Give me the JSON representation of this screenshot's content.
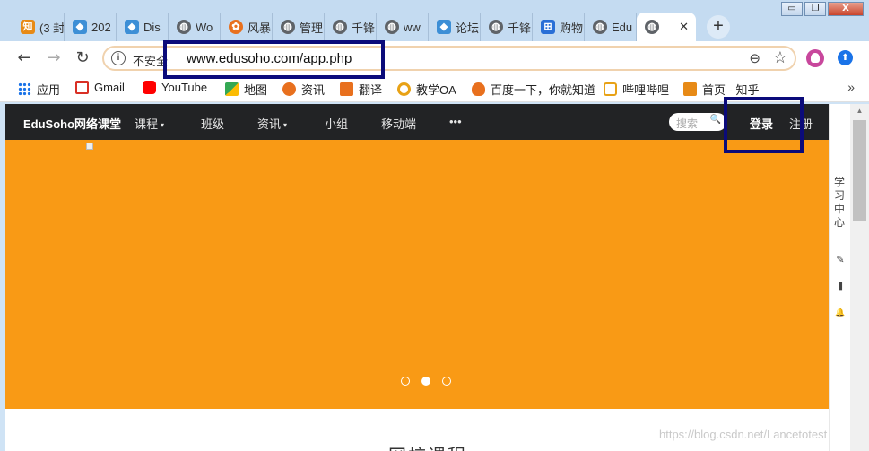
{
  "window": {
    "buttons": [
      {
        "name": "minimize",
        "glyph": "▭"
      },
      {
        "name": "restore",
        "glyph": "❐"
      },
      {
        "name": "close",
        "glyph": "X"
      }
    ]
  },
  "tabs": [
    {
      "label": "(3 封",
      "icon": "zhi",
      "glyph": "知"
    },
    {
      "label": "202",
      "icon": "shield",
      "glyph": "◆"
    },
    {
      "label": "Dis",
      "icon": "shield",
      "glyph": "◆"
    },
    {
      "label": "Wo",
      "icon": "globe",
      "glyph": "◍"
    },
    {
      "label": "风暴",
      "icon": "paw",
      "glyph": "✿"
    },
    {
      "label": "管理",
      "icon": "globe",
      "glyph": "◍"
    },
    {
      "label": "千锋",
      "icon": "globe",
      "glyph": "◍"
    },
    {
      "label": "ww",
      "icon": "globe",
      "glyph": "◍"
    },
    {
      "label": "论坛",
      "icon": "shield",
      "glyph": "◆"
    },
    {
      "label": "千锋",
      "icon": "globe",
      "glyph": "◍"
    },
    {
      "label": "购物",
      "icon": "cart",
      "glyph": "⊞"
    },
    {
      "label": "Edu",
      "icon": "globe",
      "glyph": "◍"
    }
  ],
  "active_tab": {
    "icon": "globe",
    "glyph": "◍",
    "close_glyph": "✕"
  },
  "new_tab_glyph": "+",
  "toolbar": {
    "back": "←",
    "forward": "→",
    "reload": "↻",
    "info_glyph": "i",
    "security_label": "不安全",
    "url": "www.edusoho.com/app.php",
    "zoom_glyph": "⊖",
    "star_glyph": "☆",
    "ext_glyph": "⬆"
  },
  "bookmarks": [
    {
      "label": "应用",
      "icon": "apps-icon",
      "color": "#1a73e8"
    },
    {
      "label": "Gmail",
      "icon": "gmail-icon",
      "color": "#d93025"
    },
    {
      "label": "YouTube",
      "icon": "youtube-icon",
      "color": "#ff0000"
    },
    {
      "label": "地图",
      "icon": "maps-icon",
      "color": "#34a853"
    },
    {
      "label": "资讯",
      "icon": "news-icon",
      "color": "#e8701e"
    },
    {
      "label": "翻译",
      "icon": "translate-icon",
      "color": "#e8701e"
    },
    {
      "label": "教学OA",
      "icon": "oa-icon",
      "color": "#e8a216"
    },
    {
      "label": "百度一下，你就知道",
      "icon": "baidu-icon",
      "color": "#e8701e"
    },
    {
      "label": "哔哩哔哩",
      "icon": "bilibili-icon",
      "color": "#e8a216"
    },
    {
      "label": "首页 - 知乎",
      "icon": "zhihu-icon",
      "color": "#e78a16"
    }
  ],
  "bookmarks_more": "»",
  "site": {
    "logo": "EduSoho网络课堂",
    "nav": [
      {
        "label": "课程",
        "dropdown": true
      },
      {
        "label": "班级",
        "dropdown": false
      },
      {
        "label": "资讯",
        "dropdown": true
      },
      {
        "label": "小组",
        "dropdown": false
      },
      {
        "label": "移动端",
        "dropdown": false
      },
      {
        "label": "•••",
        "dropdown": false
      }
    ],
    "caret": "▾",
    "search_placeholder": "搜索",
    "search_glyph": "🔍",
    "login": "登录",
    "register": "注册",
    "carousel_active": 1,
    "carousel_count": 3,
    "section_title": "网校课程",
    "banner_color": "#f99a15"
  },
  "side_panel": {
    "title": "学习中心",
    "icons": [
      {
        "name": "pencil-icon",
        "glyph": "✎"
      },
      {
        "name": "book-icon",
        "glyph": "▮"
      },
      {
        "name": "bell-icon",
        "glyph": "🔔"
      }
    ]
  },
  "watermark": "https://blog.csdn.net/Lancetotest"
}
